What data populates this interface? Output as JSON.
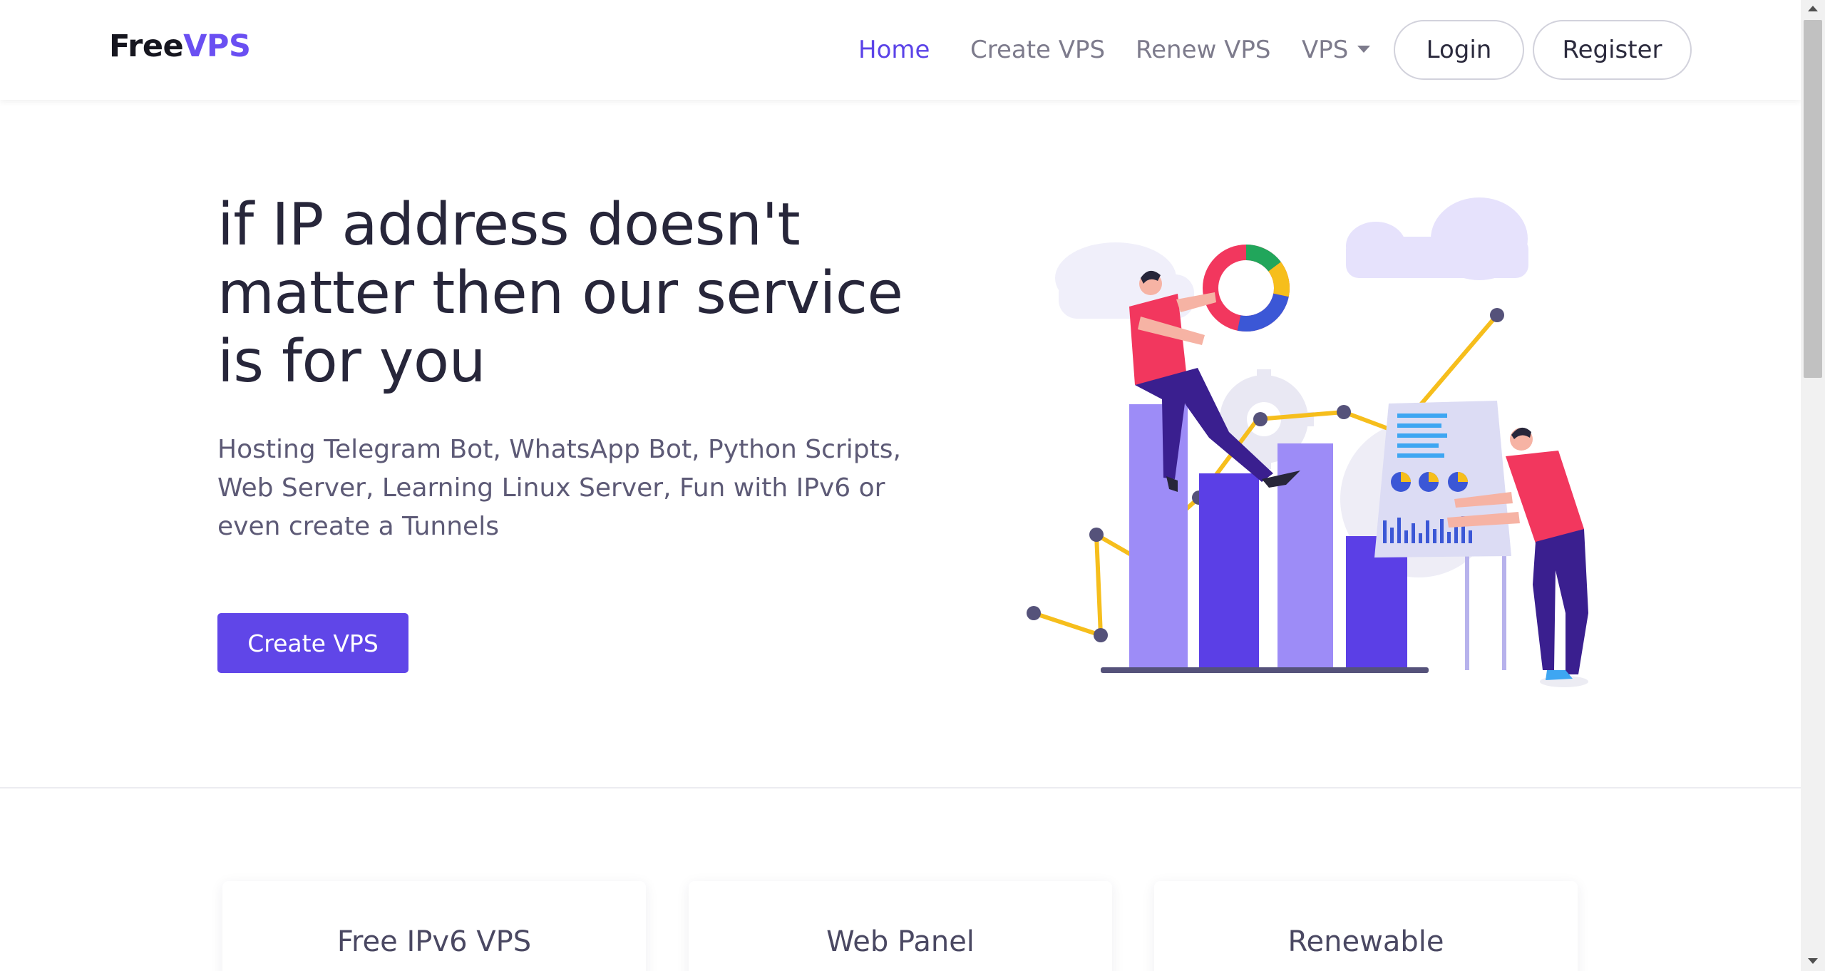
{
  "navbar": {
    "brand_part1": "Free",
    "brand_part2": "VPS",
    "links": [
      {
        "label": "Home",
        "active": true
      },
      {
        "label": "Create VPS",
        "active": false
      },
      {
        "label": "Renew VPS",
        "active": false
      },
      {
        "label": "VPS",
        "active": false,
        "dropdown": true
      }
    ],
    "login_label": "Login",
    "register_label": "Register"
  },
  "hero": {
    "title_line1": "if IP address doesn't",
    "title_line2": "matter then our service",
    "title_line3": "is for you",
    "subtitle_line1": "Hosting Telegram Bot, WhatsApp Bot, Python Scripts,",
    "subtitle_line2": "Web Server, Learning Linux Server, Fun with IPv6 or",
    "subtitle_line3": "even create a Tunnels",
    "cta_label": "Create VPS"
  },
  "features": [
    {
      "title": "Free IPv6 VPS"
    },
    {
      "title": "Web Panel"
    },
    {
      "title": "Renewable"
    }
  ],
  "colors": {
    "accent": "#6046e8",
    "brand_accent": "#6a4ff2",
    "nav_active": "#5b43e8",
    "nav_text": "#7d7b8c",
    "heading": "#27263a",
    "body_text": "#5d5a76",
    "illustration_bar_light": "#9d8cf7",
    "illustration_bar_dark": "#5b3fe6",
    "illustration_line": "#f6be1c",
    "illustration_shirt": "#f2375e"
  },
  "icons": {
    "vps_dropdown": "caret-down-icon",
    "scroll_up": "triangle-up-icon",
    "scroll_down": "triangle-down-icon"
  }
}
